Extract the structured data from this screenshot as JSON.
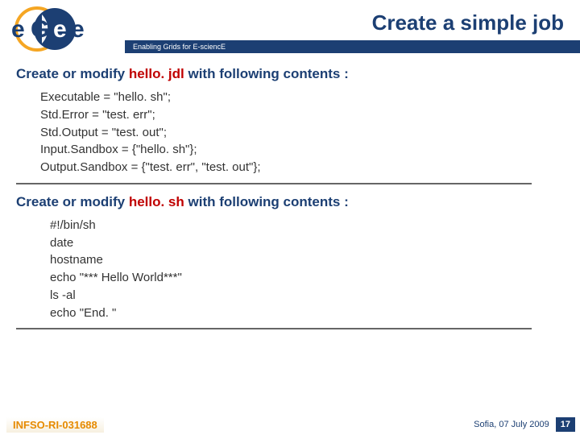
{
  "header": {
    "title": "Create a simple job",
    "tagline": "Enabling Grids for E-sciencE",
    "logo_text": "eGee"
  },
  "section1": {
    "heading_before": "Create or modify ",
    "heading_fname": "hello. jdl",
    "heading_after": " with following contents :",
    "lines": [
      "Executable = \"hello. sh\";",
      "Std.Error = \"test. err\";",
      "Std.Output = \"test. out\";",
      "Input.Sandbox = {\"hello. sh\"};",
      "Output.Sandbox = {\"test. err\", \"test. out\"};"
    ]
  },
  "section2": {
    "heading_before": "Create or modify ",
    "heading_fname": "hello. sh",
    "heading_after": " with following contents :",
    "lines": [
      "#!/bin/sh",
      "date",
      "hostname",
      "echo \"*** Hello World***\"",
      "ls -al",
      "echo \"End. \""
    ]
  },
  "footer": {
    "left": "INFSO-RI-031688",
    "date": "Sofia, 07 July 2009",
    "page": "17"
  }
}
